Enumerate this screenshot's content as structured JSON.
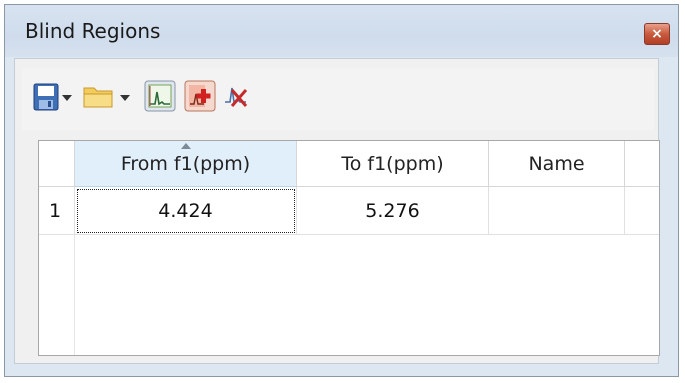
{
  "window": {
    "title": "Blind Regions",
    "close_glyph": "×"
  },
  "toolbar": {
    "icons": [
      "save-icon",
      "folder-open-icon",
      "spectrum-region-icon",
      "add-region-icon",
      "remove-region-icon"
    ],
    "dropdown_glyph": "▾"
  },
  "table": {
    "columns": [
      "From f1(ppm)",
      "To f1(ppm)",
      "Name"
    ],
    "sorted_column": "From f1(ppm)",
    "rows": [
      {
        "index": "1",
        "from": "4.424",
        "to": "5.276",
        "name": ""
      }
    ]
  },
  "colors": {
    "title_bg": "#d3dfed",
    "close_red": "#c85a3e",
    "sorted_header": "#e1effa"
  }
}
